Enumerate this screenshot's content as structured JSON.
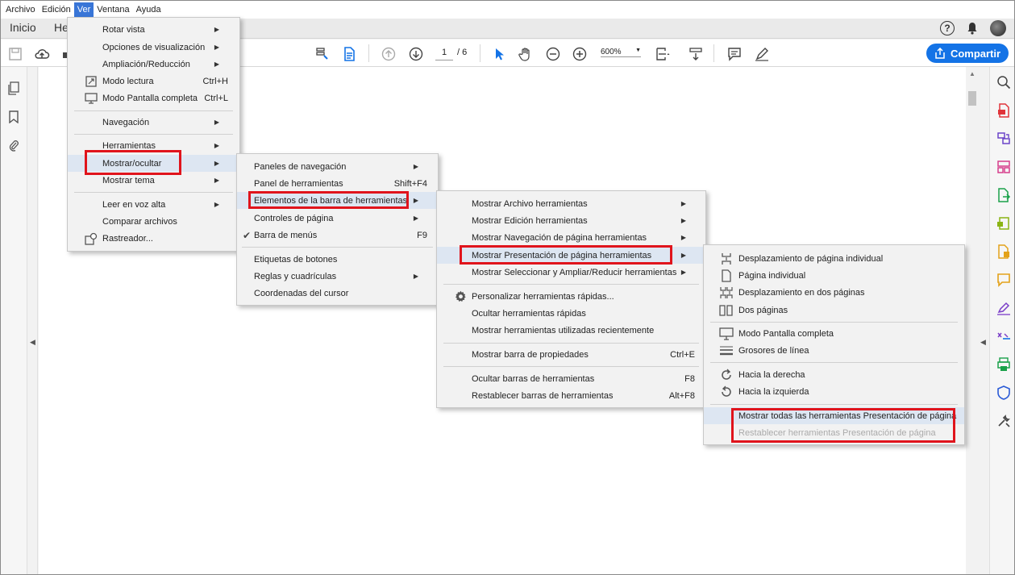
{
  "menubar": [
    "Archivo",
    "Edición",
    "Ver",
    "Ventana",
    "Ayuda"
  ],
  "tabs": {
    "home": "Inicio",
    "tools": "He"
  },
  "toolbar": {
    "page_current": "1",
    "page_total": "/ 6",
    "zoom": "600%",
    "share_label": "Compartir"
  },
  "menu_ver": {
    "items": [
      {
        "label": "Rotar vista",
        "arrow": true
      },
      {
        "label": "Opciones de visualización",
        "arrow": true
      },
      {
        "label": "Ampliación/Reducción",
        "arrow": true
      },
      {
        "label": "Modo lectura",
        "shortcut": "Ctrl+H",
        "icon": "reading-mode-icon"
      },
      {
        "label": "Modo Pantalla completa",
        "shortcut": "Ctrl+L",
        "icon": "fullscreen-icon"
      },
      {
        "label": "Navegación",
        "arrow": true
      },
      {
        "label": "Herramientas",
        "arrow": true
      },
      {
        "label": "Mostrar/ocultar",
        "arrow": true,
        "highlighted": true
      },
      {
        "label": "Mostrar tema",
        "arrow": true
      },
      {
        "label": "Leer en voz alta",
        "arrow": true
      },
      {
        "label": "Comparar archivos"
      },
      {
        "label": "Rastreador...",
        "icon": "tracker-icon"
      }
    ]
  },
  "menu_mostrar": {
    "items": [
      {
        "label": "Paneles de navegación",
        "arrow": true
      },
      {
        "label": "Panel de herramientas",
        "shortcut": "Shift+F4"
      },
      {
        "label": "Elementos de la barra de herramientas",
        "arrow": true,
        "highlighted": true
      },
      {
        "label": "Controles de página",
        "arrow": true
      },
      {
        "label": "Barra de menús",
        "shortcut": "F9",
        "checked": true
      },
      {
        "label": "Etiquetas de botones"
      },
      {
        "label": "Reglas y cuadrículas",
        "arrow": true
      },
      {
        "label": "Coordenadas del cursor"
      }
    ]
  },
  "menu_elementos": {
    "items": [
      {
        "label": "Mostrar Archivo herramientas",
        "arrow": true
      },
      {
        "label": "Mostrar Edición herramientas",
        "arrow": true
      },
      {
        "label": "Mostrar Navegación de página herramientas",
        "arrow": true
      },
      {
        "label": "Mostrar Presentación de página herramientas",
        "arrow": true,
        "highlighted": true
      },
      {
        "label": "Mostrar Seleccionar y Ampliar/Reducir herramientas",
        "arrow": true
      },
      {
        "label": "Personalizar herramientas rápidas...",
        "icon": "gear-icon"
      },
      {
        "label": "Ocultar herramientas rápidas"
      },
      {
        "label": "Mostrar herramientas utilizadas recientemente"
      },
      {
        "label": "Mostrar barra de propiedades",
        "shortcut": "Ctrl+E"
      },
      {
        "label": "Ocultar barras de herramientas",
        "shortcut": "F8"
      },
      {
        "label": "Restablecer barras de herramientas",
        "shortcut": "Alt+F8"
      }
    ]
  },
  "menu_presentacion": {
    "items": [
      {
        "label": "Desplazamiento de página individual",
        "icon": "single-page-scroll-icon"
      },
      {
        "label": "Página individual",
        "icon": "single-page-icon"
      },
      {
        "label": "Desplazamiento en dos páginas",
        "icon": "two-page-scroll-icon"
      },
      {
        "label": "Dos páginas",
        "icon": "two-pages-icon"
      },
      {
        "label": "Modo Pantalla completa",
        "icon": "fullscreen-icon"
      },
      {
        "label": "Grosores de línea",
        "icon": "line-weights-icon"
      },
      {
        "label": "Hacia la derecha",
        "icon": "rotate-right-icon"
      },
      {
        "label": "Hacia la izquierda",
        "icon": "rotate-left-icon"
      },
      {
        "label": "Mostrar todas las herramientas Presentación de página",
        "highlighted": true
      },
      {
        "label": "Restablecer herramientas Presentación de página",
        "disabled": true
      }
    ]
  },
  "colors": {
    "accent": "#1473e6",
    "highlight_box": "#e0141c",
    "menu_hover": "#dde6f2"
  }
}
